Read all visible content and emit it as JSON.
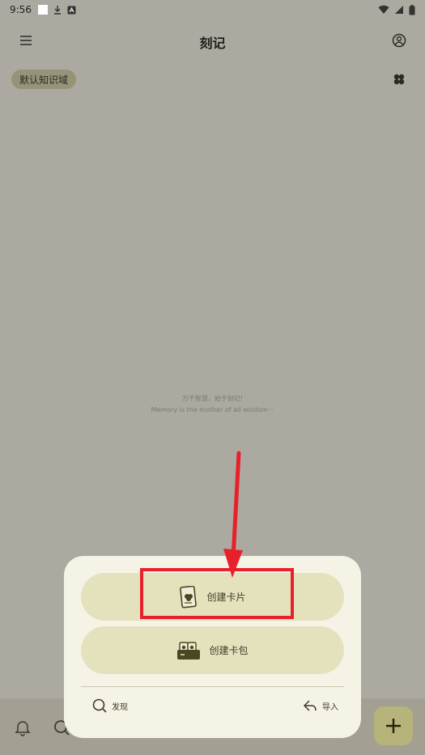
{
  "status_bar": {
    "time": "9:56"
  },
  "app_bar": {
    "title": "刻记"
  },
  "knowledge_base": {
    "chip_label": "默认知识域"
  },
  "empty_state": {
    "line_cn": "万千智慧，始于刻记!",
    "line_en": "Memory is the mother of all wisdom···"
  },
  "sheet": {
    "create_card": "创建卡片",
    "create_pack": "创建卡包",
    "discover": "发现",
    "import": "导入"
  },
  "colors": {
    "backdrop": "#aca9a0",
    "sheet_bg": "#f5f3e5",
    "sheet_button_bg": "#e4e2bd",
    "chip_bg": "#979379",
    "fab_bg": "#b6b47a",
    "annotation_red": "#e8202c",
    "icon_olive": "#5c5a2a"
  },
  "icons": {
    "menu": "hamburger-menu-icon",
    "profile": "account-circle-icon",
    "clover": "clover-icon",
    "card": "card-icon",
    "pack": "card-pack-icon",
    "discover": "search-icon",
    "import": "import-icon",
    "bell": "bell-icon",
    "fab": "plus-icon"
  }
}
